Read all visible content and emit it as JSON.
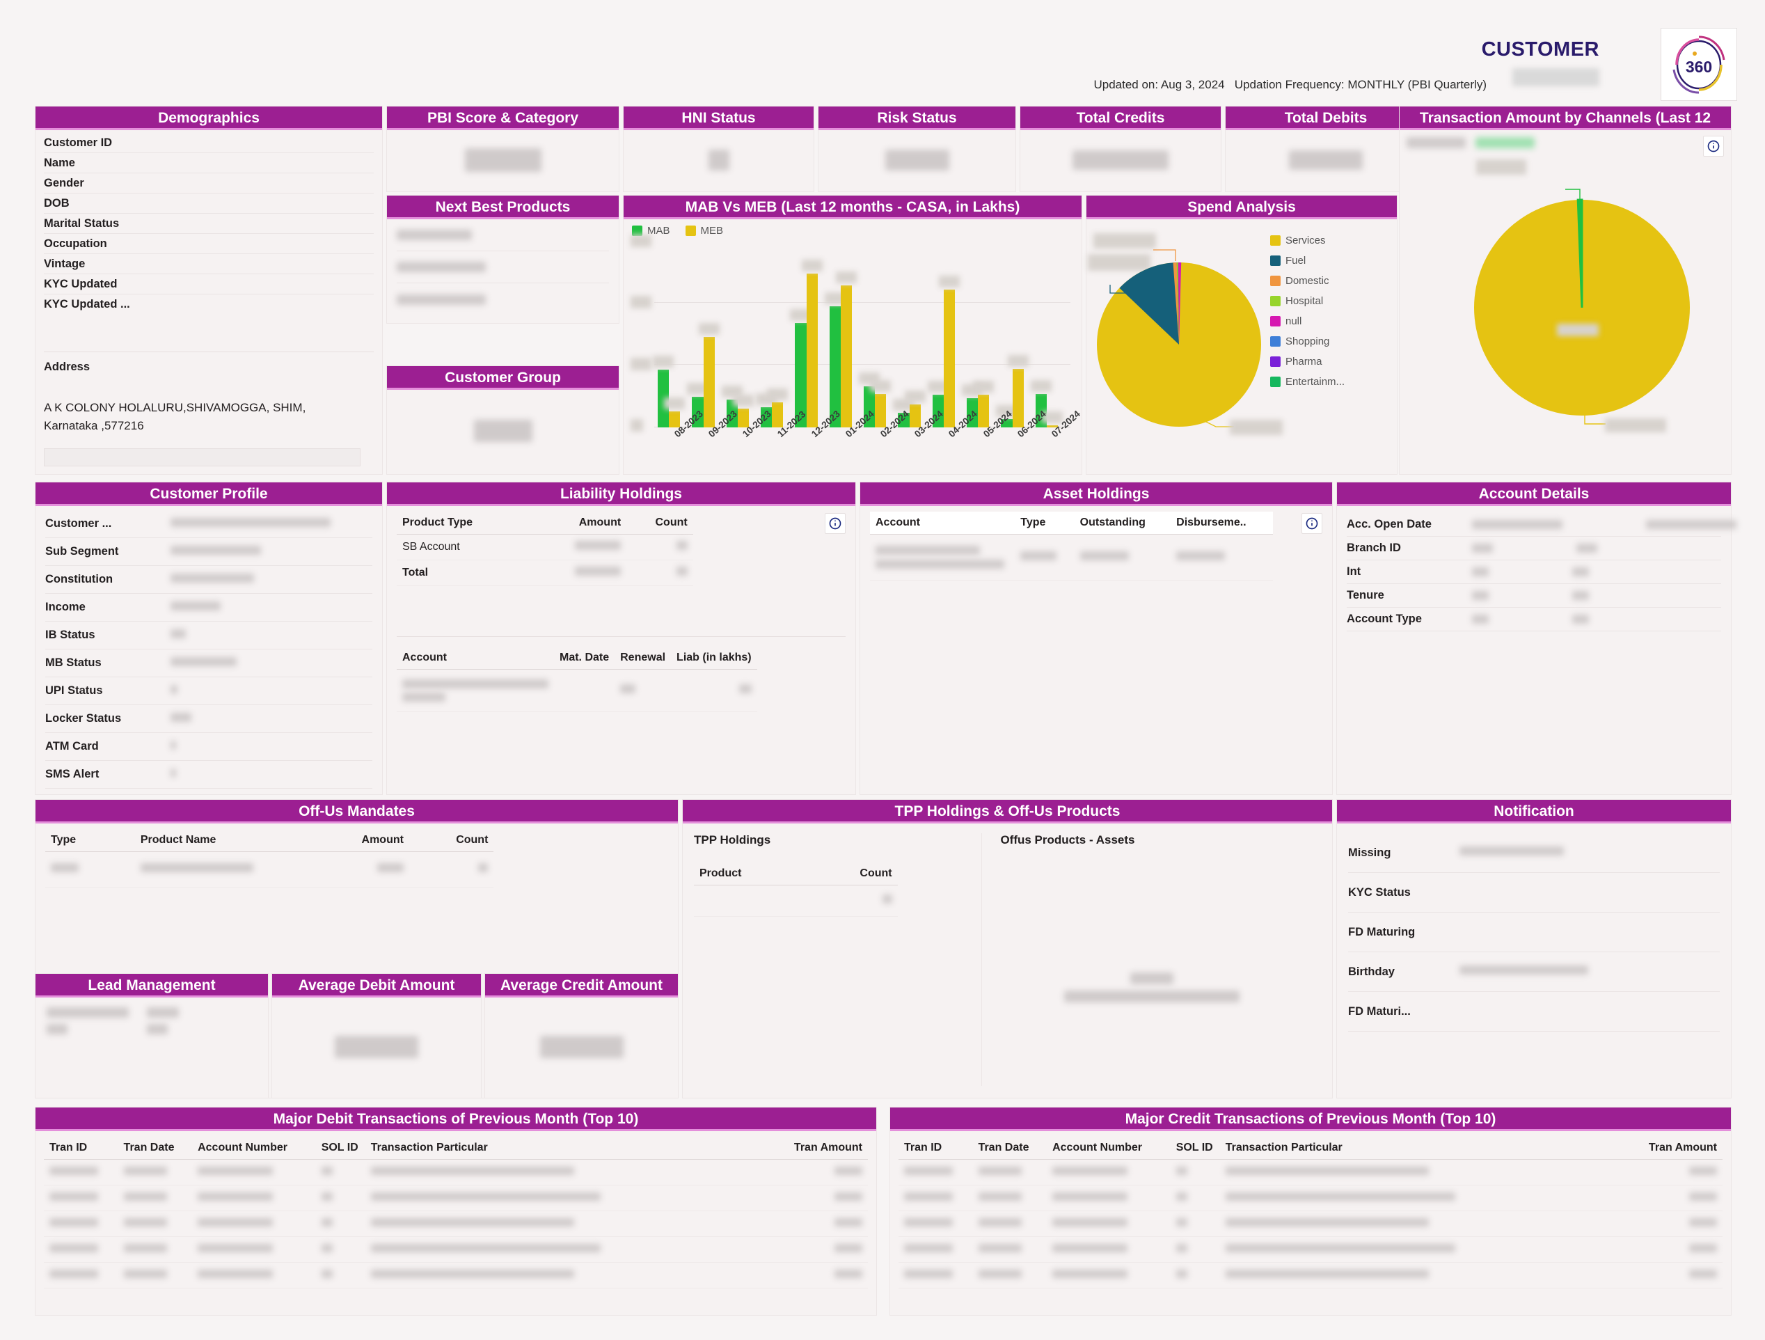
{
  "header": {
    "brand_title": "CUSTOMER",
    "logo_text": "360",
    "updated_on_label": "Updated on:",
    "updated_on_value": "Aug 3, 2024",
    "frequency_label": "Updation Frequency:",
    "frequency_value": "MONTHLY (PBI Quarterly)"
  },
  "panels": {
    "demographics": "Demographics",
    "pbi_score": "PBI Score & Category",
    "hni_status": "HNI Status",
    "risk_status": "Risk Status",
    "total_credits": "Total Credits",
    "total_debits": "Total Debits",
    "transaction_channels": "Transaction Amount by Channels (Last 12",
    "next_best_products": "Next Best Products",
    "mab_meb": "MAB Vs MEB (Last 12 months - CASA, in Lakhs)",
    "spend_analysis": "Spend Analysis",
    "customer_group": "Customer Group",
    "customer_profile": "Customer Profile",
    "liability_holdings": "Liability Holdings",
    "asset_holdings": "Asset Holdings",
    "account_details": "Account Details",
    "offus_mandates": "Off-Us Mandates",
    "tpp_holdings_offus": "TPP Holdings & Off-Us Products",
    "notification": "Notification",
    "lead_management": "Lead Management",
    "avg_debit": "Average Debit Amount",
    "avg_credit": "Average Credit Amount",
    "major_debit": "Major Debit Transactions of Previous Month (Top 10)",
    "major_credit": "Major Credit Transactions of Previous Month (Top 10)"
  },
  "demographics": {
    "rows": [
      "Customer ID",
      "Name",
      "Gender",
      "DOB",
      "Marital Status",
      "Occupation",
      "Vintage",
      "KYC Updated",
      "KYC Updated ..."
    ],
    "address_label": "Address",
    "address_value": "A K COLONY HOLALURU,SHIVAMOGGA, SHIM, Karnataka ,577216"
  },
  "customer_profile": {
    "rows": [
      "Customer ...",
      "Sub Segment",
      "Constitution",
      "Income",
      "IB Status",
      "MB Status",
      "UPI Status",
      "Locker Status",
      "ATM Card",
      "SMS Alert"
    ]
  },
  "account_details": {
    "rows": [
      "Acc. Open Date",
      "Branch ID",
      "Int",
      "Tenure",
      "Account Type"
    ]
  },
  "notification": {
    "rows": [
      "Missing",
      "KYC Status",
      "FD Maturing",
      "Birthday",
      "FD Maturi..."
    ]
  },
  "liability_holdings": {
    "headers": [
      "Product Type",
      "Amount",
      "Count"
    ],
    "rows": [
      "SB Account",
      "Total"
    ],
    "sub_headers": [
      "Account",
      "Mat. Date",
      "Renewal",
      "Liab (in lakhs)"
    ]
  },
  "asset_holdings": {
    "headers": [
      "Account",
      "Type",
      "Outstanding",
      "Disburseme.."
    ]
  },
  "offus_mandates": {
    "headers": [
      "Type",
      "Product Name",
      "Amount",
      "Count"
    ]
  },
  "tpp": {
    "tpp_label": "TPP Holdings",
    "offus_label": "Offus Products - Assets",
    "headers": [
      "Product",
      "Count"
    ]
  },
  "transactions": {
    "headers": [
      "Tran ID",
      "Tran Date",
      "Account Number",
      "SOL ID",
      "Transaction Particular",
      "Tran Amount"
    ],
    "row_count": 5
  },
  "colors": {
    "header_purple": "#9C1F92",
    "header_underline": "#e48fdb",
    "mab_green": "#21C040",
    "meb_yellow": "#E5C312",
    "fuel_teal": "#15607A",
    "domestic_orange": "#F0953F",
    "hospital_lime": "#97D42B",
    "null_magenta": "#D618B0",
    "shopping_blue": "#3E7FD8",
    "pharma_purple": "#7A21D8",
    "entertainment_green": "#16B75E",
    "page_bg": "#f7f4f4"
  },
  "chart_data": [
    {
      "type": "bar",
      "title": "MAB Vs MEB (Last 12 months - CASA, in Lakhs)",
      "xlabel": "",
      "ylabel": "",
      "grid": true,
      "legend_position": "top-left",
      "categories": [
        "08-2023",
        "09-2023",
        "10-2023",
        "11-2023",
        "12-2023",
        "01-2024",
        "02-2024",
        "03-2024",
        "04-2024",
        "05-2024",
        "06-2024",
        "07-2024"
      ],
      "series": [
        {
          "name": "MAB",
          "color": "#21C040",
          "values": [
            0.62,
            0.33,
            0.3,
            0.22,
            1.12,
            1.3,
            0.44,
            0.16,
            0.35,
            0.31,
            0.09,
            0.36
          ]
        },
        {
          "name": "MEB",
          "color": "#E5C312",
          "values": [
            0.17,
            0.97,
            0.2,
            0.27,
            1.65,
            1.52,
            0.36,
            0.25,
            1.48,
            0.35,
            0.63,
            0.02
          ]
        }
      ],
      "ylim": [
        0,
        2.0
      ]
    },
    {
      "type": "pie",
      "title": "Spend Analysis",
      "legend_position": "right",
      "labels": [
        "Services",
        "Fuel",
        "Domestic",
        "Hospital",
        "null",
        "Shopping",
        "Pharma",
        "Entertainm..."
      ],
      "colors": [
        "#E5C312",
        "#15607A",
        "#F0953F",
        "#97D42B",
        "#D618B0",
        "#3E7FD8",
        "#7A21D8",
        "#16B75E"
      ],
      "values": [
        84.0,
        13.2,
        1.2,
        0.4,
        0.7,
        0.2,
        0.2,
        0.1
      ]
    },
    {
      "type": "pie",
      "title": "Transaction Amount by Channels (Last 12",
      "legend_position": "top-left",
      "labels": [
        "Channel A",
        "Channel B"
      ],
      "colors": [
        "#E5C312",
        "#21C040"
      ],
      "values": [
        98.6,
        1.4
      ]
    }
  ]
}
